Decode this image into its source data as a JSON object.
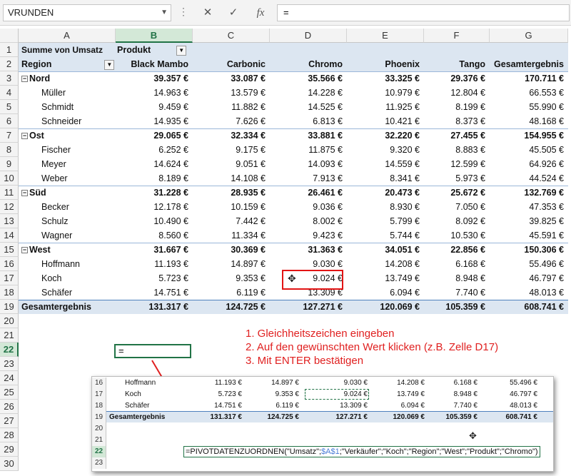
{
  "formula_bar": {
    "name_box": "VRUNDEN",
    "formula": "=",
    "cancel_icon": "✕",
    "confirm_icon": "✓",
    "fx_label": "fx"
  },
  "columns": [
    "A",
    "B",
    "C",
    "D",
    "E",
    "F",
    "G"
  ],
  "rows": [
    "1",
    "2",
    "3",
    "4",
    "5",
    "6",
    "7",
    "8",
    "9",
    "10",
    "11",
    "12",
    "13",
    "14",
    "15",
    "16",
    "17",
    "18",
    "19",
    "20",
    "21",
    "22",
    "23",
    "24",
    "25",
    "26",
    "27",
    "28",
    "29",
    "30"
  ],
  "pivot": {
    "value_field": "Summe von Umsatz",
    "column_field": "Produkt",
    "row_field": "Region",
    "products": [
      "Black Mambo",
      "Carbonic",
      "Chromo",
      "Phoenix",
      "Tango",
      "Gesamtergebnis"
    ],
    "groups": [
      {
        "region": "Nord",
        "totals": [
          "39.357 €",
          "33.087 €",
          "35.566 €",
          "33.325 €",
          "29.376 €",
          "170.711 €"
        ],
        "members": [
          {
            "name": "Müller",
            "values": [
              "14.963 €",
              "13.579 €",
              "14.228 €",
              "10.979 €",
              "12.804 €",
              "66.553 €"
            ]
          },
          {
            "name": "Schmidt",
            "values": [
              "9.459 €",
              "11.882 €",
              "14.525 €",
              "11.925 €",
              "8.199 €",
              "55.990 €"
            ]
          },
          {
            "name": "Schneider",
            "values": [
              "14.935 €",
              "7.626 €",
              "6.813 €",
              "10.421 €",
              "8.373 €",
              "48.168 €"
            ]
          }
        ]
      },
      {
        "region": "Ost",
        "totals": [
          "29.065 €",
          "32.334 €",
          "33.881 €",
          "32.220 €",
          "27.455 €",
          "154.955 €"
        ],
        "members": [
          {
            "name": "Fischer",
            "values": [
              "6.252 €",
              "9.175 €",
              "11.875 €",
              "9.320 €",
              "8.883 €",
              "45.505 €"
            ]
          },
          {
            "name": "Meyer",
            "values": [
              "14.624 €",
              "9.051 €",
              "14.093 €",
              "14.559 €",
              "12.599 €",
              "64.926 €"
            ]
          },
          {
            "name": "Weber",
            "values": [
              "8.189 €",
              "14.108 €",
              "7.913 €",
              "8.341 €",
              "5.973 €",
              "44.524 €"
            ]
          }
        ]
      },
      {
        "region": "Süd",
        "totals": [
          "31.228 €",
          "28.935 €",
          "26.461 €",
          "20.473 €",
          "25.672 €",
          "132.769 €"
        ],
        "members": [
          {
            "name": "Becker",
            "values": [
              "12.178 €",
              "10.159 €",
              "9.036 €",
              "8.930 €",
              "7.050 €",
              "47.353 €"
            ]
          },
          {
            "name": "Schulz",
            "values": [
              "10.490 €",
              "7.442 €",
              "8.002 €",
              "5.799 €",
              "8.092 €",
              "39.825 €"
            ]
          },
          {
            "name": "Wagner",
            "values": [
              "8.560 €",
              "11.334 €",
              "9.423 €",
              "5.744 €",
              "10.530 €",
              "45.591 €"
            ]
          }
        ]
      },
      {
        "region": "West",
        "totals": [
          "31.667 €",
          "30.369 €",
          "31.363 €",
          "34.051 €",
          "22.856 €",
          "150.306 €"
        ],
        "members": [
          {
            "name": "Hoffmann",
            "values": [
              "11.193 €",
              "14.897 €",
              "9.030 €",
              "14.208 €",
              "6.168 €",
              "55.496 €"
            ]
          },
          {
            "name": "Koch",
            "values": [
              "5.723 €",
              "9.353 €",
              "9.024 €",
              "13.749 €",
              "8.948 €",
              "46.797 €"
            ]
          },
          {
            "name": "Schäfer",
            "values": [
              "14.751 €",
              "6.119 €",
              "13.309 €",
              "6.094 €",
              "7.740 €",
              "48.013 €"
            ]
          }
        ]
      }
    ],
    "grand_total_label": "Gesamtergebnis",
    "grand_totals": [
      "131.317 €",
      "124.725 €",
      "127.271 €",
      "120.069 €",
      "105.359 €",
      "608.741 €"
    ]
  },
  "input_cell_value": "=",
  "instructions": [
    "1. Gleichheitszeichen eingeben",
    "2. Auf den gewünschten Wert klicken (z.B. Zelle D17)",
    "3. Mit ENTER bestätigen"
  ],
  "inset": {
    "rows": [
      {
        "num": "16",
        "name": "Hoffmann",
        "values": [
          "11.193 €",
          "14.897 €",
          "9.030 €",
          "14.208 €",
          "6.168 €",
          "55.496 €"
        ]
      },
      {
        "num": "17",
        "name": "Koch",
        "values": [
          "5.723 €",
          "9.353 €",
          "9.024 €",
          "13.749 €",
          "8.948 €",
          "46.797 €"
        ]
      },
      {
        "num": "18",
        "name": "Schäfer",
        "values": [
          "14.751 €",
          "6.119 €",
          "13.309 €",
          "6.094 €",
          "7.740 €",
          "48.013 €"
        ]
      },
      {
        "num": "19",
        "name": "Gesamtergebnis",
        "values": [
          "131.317 €",
          "124.725 €",
          "127.271 €",
          "120.069 €",
          "105.359 €",
          "608.741 €"
        ]
      }
    ],
    "empty_rows": [
      "20",
      "21",
      "22",
      "23"
    ],
    "formula_prefix": "=PIVOTDATENZUORDNEN(\"Umsatz\";",
    "formula_ref": "$A$1",
    "formula_suffix": ";\"Verkäufer\";\"Koch\";\"Region\";\"West\";\"Produkt\";\"Chromo\")"
  }
}
